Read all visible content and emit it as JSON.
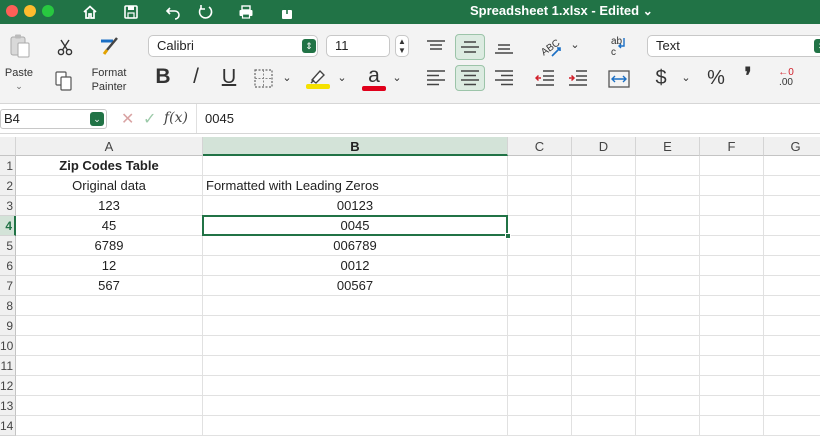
{
  "titlebar": {
    "title": "Spreadsheet 1.xlsx - Edited",
    "chevron": "⌄",
    "icons": [
      "home-icon",
      "save-icon",
      "undo-icon",
      "redo-icon",
      "print-icon",
      "share-icon"
    ]
  },
  "ribbon": {
    "paste_label": "Paste",
    "format_painter_label_1": "Format",
    "format_painter_label_2": "Painter",
    "font_name": "Calibri",
    "font_size": "11",
    "bold": "B",
    "italic": "/",
    "underline": "U",
    "font_color_letter": "a",
    "number_format": "Text",
    "currency_symbol": "$",
    "percent_symbol": "%",
    "comma_symbol": "❜",
    "dec_increase_top": "←0",
    "dec_increase_bottom": ".00",
    "highlight_color": "#f5e100",
    "font_color": "#e0001b"
  },
  "formula_bar": {
    "name_box": "B4",
    "fx": "f(x)",
    "content": "0045"
  },
  "columns": [
    "A",
    "B",
    "C",
    "D",
    "E",
    "F",
    "G"
  ],
  "rows": [
    "1",
    "2",
    "3",
    "4",
    "5",
    "6",
    "7",
    "8",
    "9",
    "10",
    "11",
    "12",
    "13",
    "14"
  ],
  "selected": {
    "column": "B",
    "row": "4"
  },
  "cells": {
    "A1": "Zip Codes Table",
    "A2": "Original data",
    "B2": "Formatted with Leading Zeros",
    "A3": "123",
    "B3": "00123",
    "A4": "45",
    "B4": "0045",
    "A5": "6789",
    "B5": "006789",
    "A6": "12",
    "B6": "0012",
    "A7": "567",
    "B7": "00567"
  },
  "colors": {
    "accent": "#217346",
    "selection_header": "#d3e3d8"
  }
}
